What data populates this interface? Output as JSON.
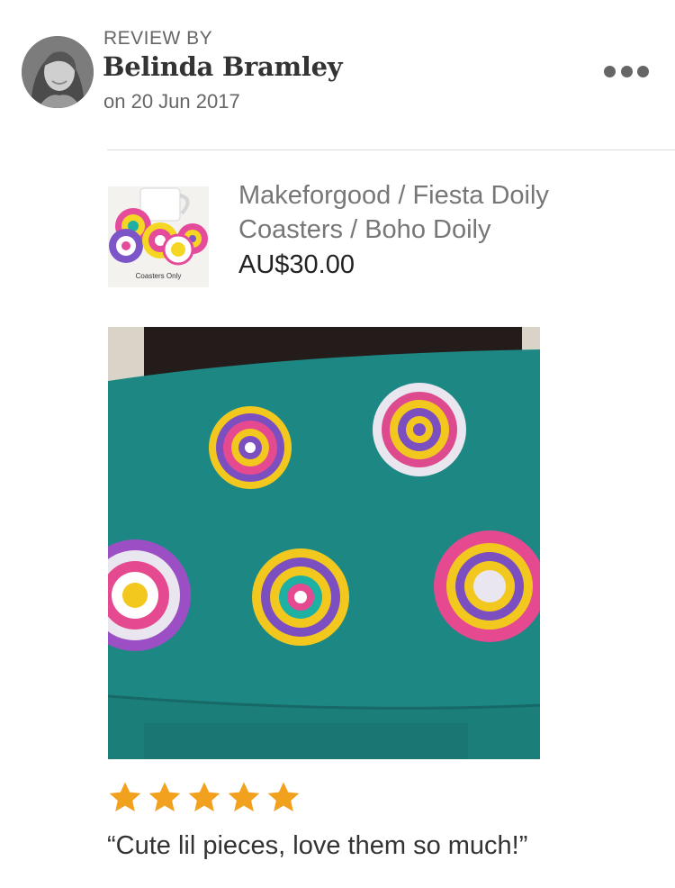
{
  "reviewer": {
    "label": "REVIEW BY",
    "name": "Belinda Bramley",
    "date": "on 20 Jun 2017",
    "avatar_icon": "avatar-photo"
  },
  "menu": {
    "icon": "more-horizontal-icon"
  },
  "listing": {
    "title": "Makeforgood / Fiesta Doily Coasters / Boho Doily",
    "price": "AU$30.00",
    "thumbnail_caption": "Coasters Only"
  },
  "review": {
    "rating": 5,
    "rating_max": 5,
    "star_color": "#f1a11e",
    "text": "“Cute lil pieces, love them so much!”"
  },
  "colors": {
    "muted_text": "#666666",
    "divider": "#dddddd",
    "table_teal": "#1e8a86"
  }
}
